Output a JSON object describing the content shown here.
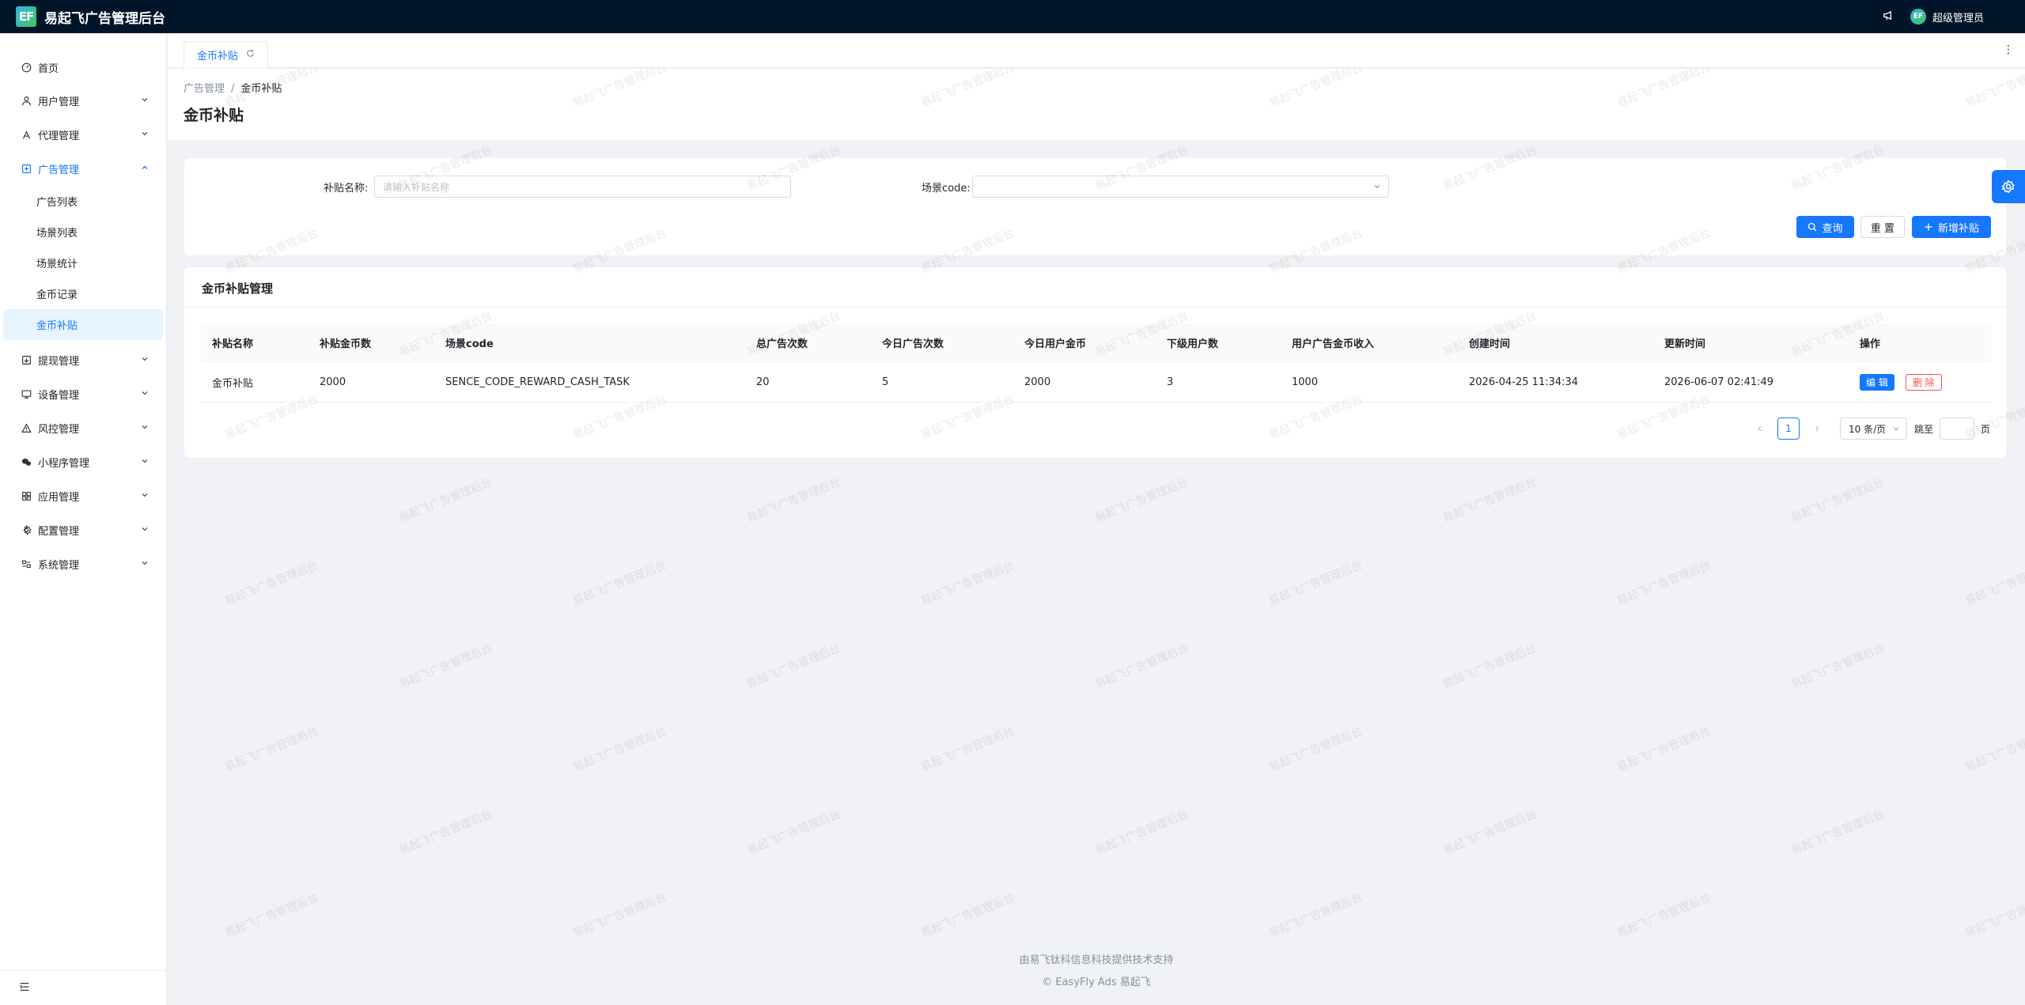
{
  "app": {
    "logo_text": "EF",
    "title": "易起飞广告管理后台",
    "user_name": "超级管理员",
    "avatar_text": "EF"
  },
  "sidebar": {
    "items": [
      {
        "label": "首页",
        "icon": "dashboard-icon",
        "expandable": false
      },
      {
        "label": "用户管理",
        "icon": "user-icon",
        "expandable": true
      },
      {
        "label": "代理管理",
        "icon": "agent-icon",
        "expandable": true
      },
      {
        "label": "广告管理",
        "icon": "ad-icon",
        "expandable": true,
        "open": true,
        "children": [
          {
            "label": "广告列表"
          },
          {
            "label": "场景列表"
          },
          {
            "label": "场景统计"
          },
          {
            "label": "金币记录"
          },
          {
            "label": "金币补贴",
            "active": true
          }
        ]
      },
      {
        "label": "提现管理",
        "icon": "withdraw-icon",
        "expandable": true
      },
      {
        "label": "设备管理",
        "icon": "monitor-icon",
        "expandable": true
      },
      {
        "label": "风控管理",
        "icon": "warning-icon",
        "expandable": true
      },
      {
        "label": "小程序管理",
        "icon": "wechat-icon",
        "expandable": true
      },
      {
        "label": "应用管理",
        "icon": "apps-icon",
        "expandable": true
      },
      {
        "label": "配置管理",
        "icon": "settings-icon",
        "expandable": true
      },
      {
        "label": "系统管理",
        "icon": "system-icon",
        "expandable": true
      }
    ]
  },
  "tabs": [
    {
      "label": "金币补贴"
    }
  ],
  "breadcrumb": {
    "parent": "广告管理",
    "separator": "/",
    "current": "金币补贴"
  },
  "page_title": "金币补贴",
  "search": {
    "name_label": "补贴名称:",
    "name_placeholder": "请输入补贴名称",
    "scene_label": "场景code:",
    "scene_value": "",
    "query_label": "查询",
    "reset_label": "重 置",
    "add_label": "新增补贴"
  },
  "table": {
    "title": "金币补贴管理",
    "columns": [
      "补贴名称",
      "补贴金币数",
      "场景code",
      "总广告次数",
      "今日广告次数",
      "今日用户金币",
      "下级用户数",
      "用户广告金币收入",
      "创建时间",
      "更新时间",
      "操作"
    ],
    "rows": [
      [
        "金币补贴",
        "2000",
        "SENCE_CODE_REWARD_CASH_TASK",
        "20",
        "5",
        "2000",
        "3",
        "1000",
        "2026-04-25 11:34:34",
        "2026-06-07 02:41:49"
      ]
    ],
    "edit_label": "编 辑",
    "delete_label": "删 除"
  },
  "pagination": {
    "current_page": "1",
    "page_size": "10 条/页",
    "jump_label": "跳至",
    "page_suffix": "页"
  },
  "footer": {
    "line1": "由易飞钛科信息科技提供技术支持",
    "line2": "EasyFly Ads 易起飞"
  },
  "watermark": "易起飞广告管理后台",
  "colors": {
    "primary": "#1677ff",
    "header_bg": "#001529",
    "danger": "#ff4d4f"
  }
}
